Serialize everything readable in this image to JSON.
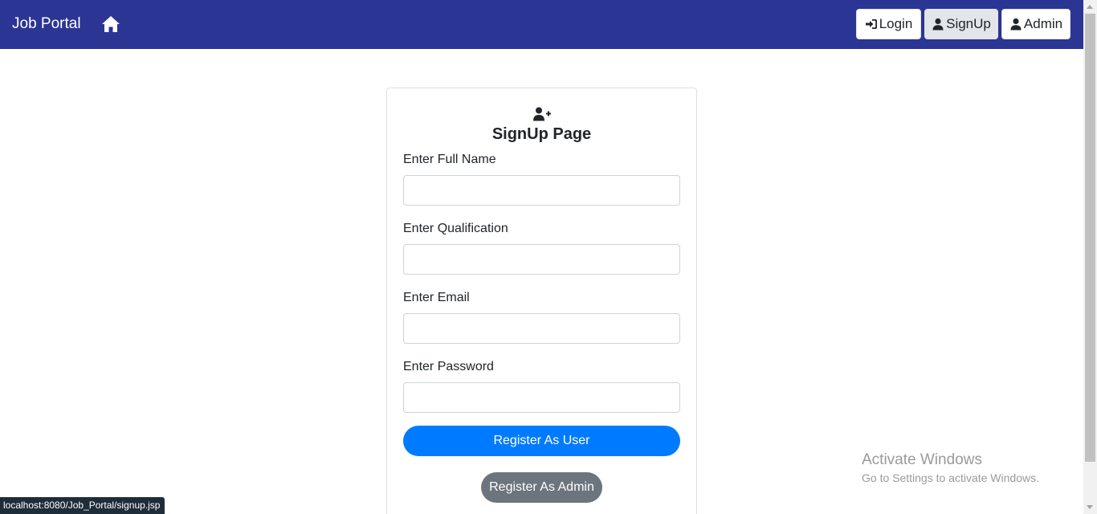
{
  "navbar": {
    "brand": "Job Portal",
    "home_icon": "home-icon",
    "buttons": [
      {
        "label": "Login",
        "icon": "sign-in-icon"
      },
      {
        "label": "SignUp",
        "icon": "user-icon"
      },
      {
        "label": "Admin",
        "icon": "user-icon"
      }
    ],
    "background": "#2b3594"
  },
  "card": {
    "icon": "user-plus-icon",
    "title": "SignUp Page",
    "fields": [
      {
        "label": "Enter Full Name",
        "value": "",
        "placeholder": ""
      },
      {
        "label": "Enter Qualification",
        "value": "",
        "placeholder": ""
      },
      {
        "label": "Enter Email",
        "value": "",
        "placeholder": ""
      },
      {
        "label": "Enter Password",
        "value": "",
        "placeholder": ""
      }
    ],
    "register_user_label": "Register As User",
    "register_admin_label": "Register As Admin",
    "primary_color": "#007bff",
    "secondary_color": "#6c757d"
  },
  "watermark": {
    "title": "Activate Windows",
    "subtitle": "Go to Settings to activate Windows."
  },
  "status_bar": {
    "url": "localhost:8080/Job_Portal/signup.jsp"
  }
}
